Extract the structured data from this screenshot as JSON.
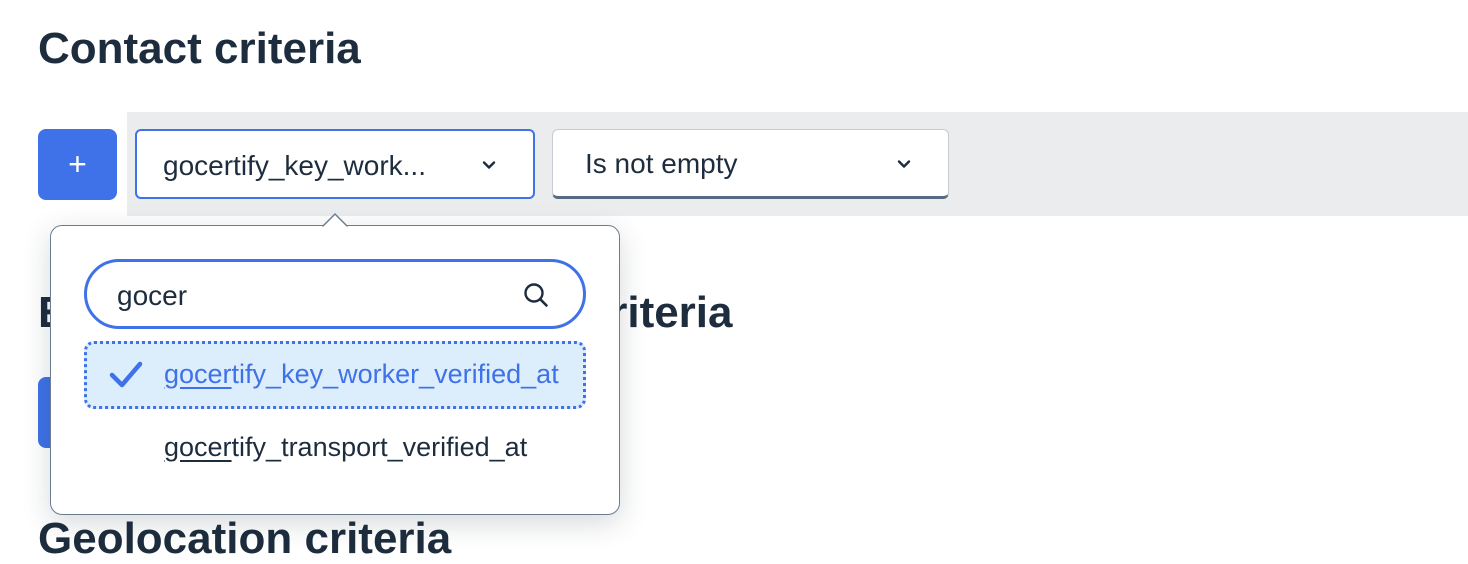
{
  "headings": {
    "contact": "Contact criteria",
    "second": "Email marketing behavior criteria",
    "third": "Geolocation criteria"
  },
  "criteria_row": {
    "add_button_label": "+",
    "field_select_value": "gocertify_key_work...",
    "operator_select_value": "Is not empty"
  },
  "dropdown": {
    "search_value": "gocer",
    "options": [
      {
        "match": "gocer",
        "rest": "tify_key_worker_verified_at",
        "selected": true
      },
      {
        "match": "gocer",
        "rest": "tify_transport_verified_at",
        "selected": false
      }
    ]
  },
  "icons": {
    "chevron": "chevron-down-icon",
    "search": "search-icon",
    "check": "check-icon"
  },
  "colors": {
    "accent": "#3f71e8",
    "text": "#1d2d3e",
    "selected_bg": "#dceefb",
    "strip_bg": "#eaecee"
  }
}
